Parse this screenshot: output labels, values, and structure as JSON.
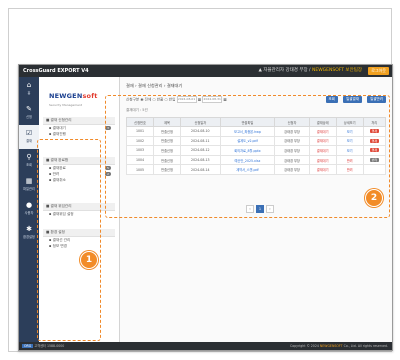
{
  "app": {
    "title": "CrossGuard EXPORT V4",
    "user_info": "▲ 자율관리자 강태경 부장 / ",
    "user_highlight": "NEWGENSOFT 보안팀장",
    "logout_label": "로그아웃"
  },
  "iconbar": [
    {
      "icon": "home-icon",
      "glyph": "⌂",
      "label": "홈"
    },
    {
      "icon": "pencil-icon",
      "glyph": "✎",
      "label": "신청"
    },
    {
      "icon": "approval-icon",
      "glyph": "☑",
      "label": "결재"
    },
    {
      "icon": "search-icon",
      "glyph": "⚲",
      "label": "조회"
    },
    {
      "icon": "grid-icon",
      "glyph": "▦",
      "label": "파일관리"
    },
    {
      "icon": "user-icon",
      "glyph": "●",
      "label": "사용자"
    },
    {
      "icon": "gear-icon",
      "glyph": "✱",
      "label": "환경설정"
    }
  ],
  "sidebar": {
    "logo_main": "NEWGEN",
    "logo_suffix": "soft",
    "logo_sub": "Security Management",
    "sections": [
      {
        "header": "■ 결재 신청관리",
        "items": [
          {
            "label": "▪ 결재대기",
            "badge": "3"
          },
          {
            "label": "▪ 결재진행",
            "badge": ""
          }
        ]
      },
      {
        "header": "■ 결재 완료함",
        "items": [
          {
            "label": "▪ 결재완료",
            "badge": "5"
          },
          {
            "label": "▪ 반려",
            "badge": "2"
          },
          {
            "label": "▪ 결재취소",
            "badge": ""
          }
        ]
      },
      {
        "header": "■ 결재 위임관리",
        "items": [
          {
            "label": "▪ 결재위임 설정",
            "badge": ""
          }
        ]
      },
      {
        "header": "■ 환경 설정",
        "items": [
          {
            "label": "▪ 결재선 관리",
            "badge": ""
          },
          {
            "label": "▪ 정보 변경",
            "badge": ""
          }
        ]
      }
    ]
  },
  "main": {
    "breadcrumb": "결재 › 결재 신청관리 › 결재대기",
    "filter_label": "신청구분",
    "radio_all": "◉ 전체",
    "radio_a": "○ 반출",
    "radio_b": "○ 반입",
    "date_from": "2024-08-01",
    "date_to": "2024-08-31",
    "btn_search": "조회",
    "btn_approve": "일괄결재",
    "btn_reject": "일괄반려",
    "subheader": "결재대기 : 5건",
    "columns": [
      "신청번호",
      "제목",
      "신청일자",
      "반출파일",
      "신청자",
      "결재상태",
      "상세보기",
      "처리"
    ],
    "rows": [
      {
        "no": "1001",
        "type": "반출신청",
        "date": "2024-08-10",
        "file": "보고서_최종본.hwp",
        "user": "강태경 부장",
        "status": "결재대기",
        "detail": "보기",
        "action": "결재"
      },
      {
        "no": "1002",
        "type": "반출신청",
        "date": "2024-08-11",
        "file": "설계도_v2.pdf",
        "user": "강태경 부장",
        "status": "결재대기",
        "detail": "보기",
        "action": "결재"
      },
      {
        "no": "1003",
        "type": "반출신청",
        "date": "2024-08-12",
        "file": "회의자료_8월.pptx",
        "user": "강태경 부장",
        "status": "결재대기",
        "detail": "보기",
        "action": "결재"
      },
      {
        "no": "1004",
        "type": "반출신청",
        "date": "2024-08-13",
        "file": "예산안_2025.xlsx",
        "user": "강태경 부장",
        "status": "결재대기",
        "detail": "반려",
        "action": "반려"
      },
      {
        "no": "1005",
        "type": "반출신청",
        "date": "2024-08-14",
        "file": "계약서_스캔.pdf",
        "user": "강태경 부장",
        "status": "결재대기",
        "detail": "반려",
        "action": ""
      }
    ],
    "pager": [
      "‹",
      "1",
      "›"
    ]
  },
  "statusbar": {
    "badge": "ORG",
    "left": "고객센터 1588-0000",
    "right_pre": "Copyright © 2024 ",
    "right_hl": "NEWGENSOFT",
    "right_post": " Co., Ltd. All rights reserved."
  },
  "callouts": [
    "1",
    "2"
  ],
  "colors": {
    "accent_orange": "#f28c28",
    "nav_dark": "#2c3e5a",
    "primary_blue": "#3a6fb5"
  }
}
